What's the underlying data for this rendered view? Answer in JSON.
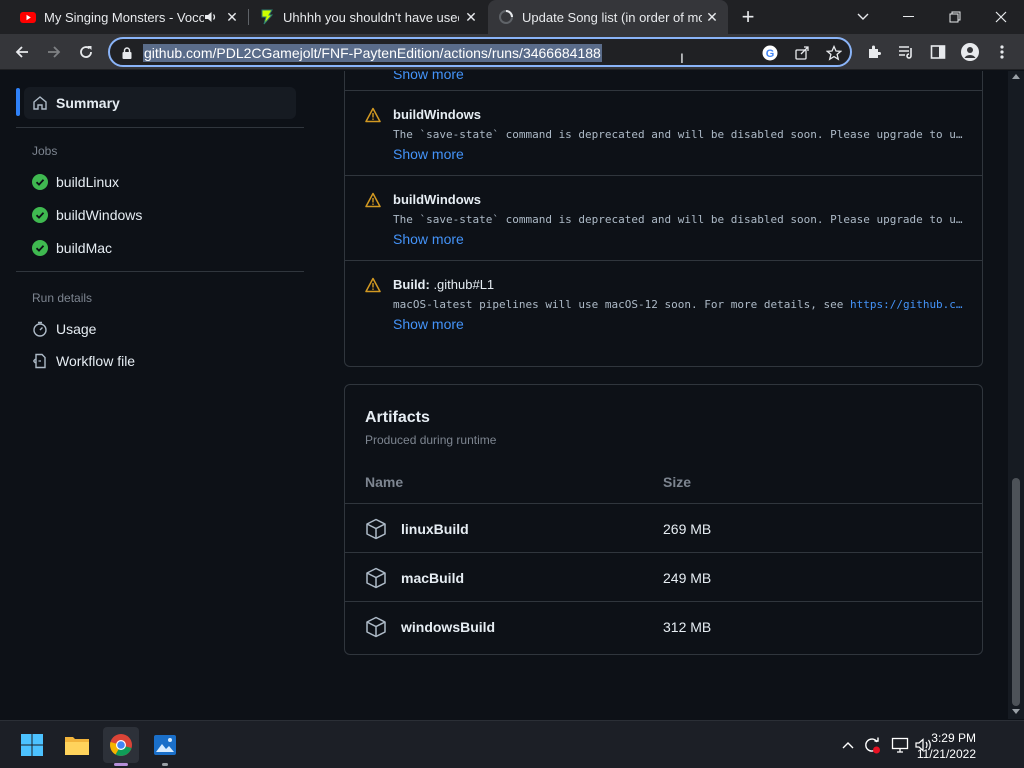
{
  "browser": {
    "tabs": [
      {
        "title": "My Singing Monsters - Voco",
        "favicon": "youtube-icon",
        "audio": "speaker-icon",
        "active": false
      },
      {
        "title": "Uhhhh you shouldn't have used t",
        "favicon": "gamejolt-icon",
        "active": false
      },
      {
        "title": "Update Song list (in order of mo",
        "favicon": "github-icon",
        "active": true
      }
    ],
    "new_tab_label": "+",
    "url": "github.com/PDL2CGamejolt/FNF-PaytenEdition/actions/runs/3466684188"
  },
  "sidebar": {
    "summary_label": "Summary",
    "jobs_heading": "Jobs",
    "jobs": [
      {
        "label": "buildLinux",
        "status": "success"
      },
      {
        "label": "buildWindows",
        "status": "success"
      },
      {
        "label": "buildMac",
        "status": "success"
      }
    ],
    "run_details_heading": "Run details",
    "details": [
      {
        "label": "Usage",
        "icon": "stopwatch-icon"
      },
      {
        "label": "Workflow file",
        "icon": "workflow-file-icon"
      }
    ]
  },
  "annotations": {
    "show_more_label": "Show more",
    "items": [
      {
        "title": "buildWindows",
        "title_rest": "",
        "message": "The `save-state` command is deprecated and will be disabled soon. Please upgrade to u…",
        "link": ""
      },
      {
        "title": "buildWindows",
        "title_rest": "",
        "message": "The `save-state` command is deprecated and will be disabled soon. Please upgrade to u…",
        "link": ""
      },
      {
        "title": "Build:",
        "title_rest": " .github#L1",
        "message": "macOS-latest pipelines will use macOS-12 soon. For more details, see ",
        "link": "https://github.c…"
      }
    ]
  },
  "artifacts": {
    "title": "Artifacts",
    "subtitle": "Produced during runtime",
    "columns": {
      "name": "Name",
      "size": "Size"
    },
    "rows": [
      {
        "name": "linuxBuild",
        "size": "269 MB"
      },
      {
        "name": "macBuild",
        "size": "249 MB"
      },
      {
        "name": "windowsBuild",
        "size": "312 MB"
      }
    ]
  },
  "taskbar": {
    "time": "3:29 PM",
    "date": "11/21/2022"
  },
  "colors": {
    "accent_blue": "#2f81f7",
    "link_blue": "#4493f8",
    "success_green": "#3fb950",
    "warning_yellow": "#d29922"
  }
}
